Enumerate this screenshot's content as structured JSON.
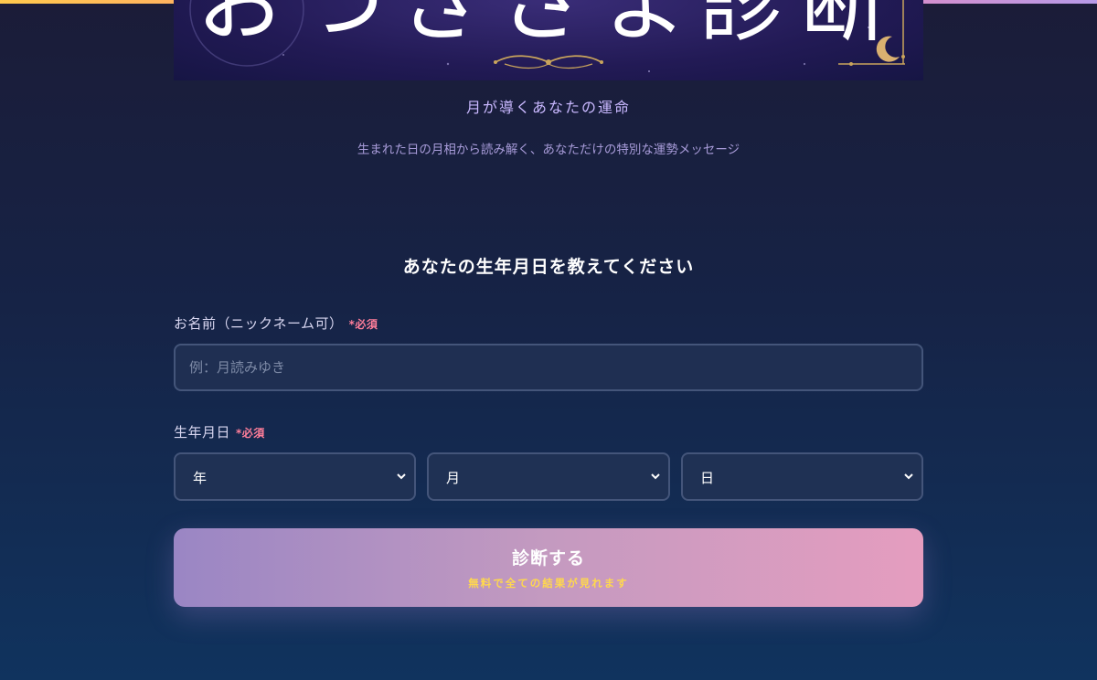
{
  "banner": {
    "title": "おつきさま診断"
  },
  "header": {
    "tagline": "月が導くあなたの運命",
    "subtitle": "生まれた日の月相から読み解く、あなただけの特別な運勢メッセージ"
  },
  "form": {
    "heading": "あなたの生年月日を教えてください",
    "name_label": "お名前（ニックネーム可）",
    "name_required": "*必須",
    "name_placeholder": "例：月読みゆき",
    "name_value": "",
    "birth_label": "生年月日",
    "birth_required": "*必須",
    "year_selected": "年",
    "month_selected": "月",
    "day_selected": "日",
    "submit_label": "診断する",
    "submit_sub": "無料で全ての結果が見れます"
  },
  "colors": {
    "accent_bar": [
      "#ffc94d",
      "#ff7fa6",
      "#b79ae8"
    ],
    "required": "#ff7e9a",
    "button_gradient": [
      "#9a86c4",
      "#e59dbf"
    ],
    "button_sub": "#ffd84d"
  },
  "icons": [
    "crescent-moon-icon",
    "ornament-flourish-icon",
    "chevron-down-icon"
  ]
}
